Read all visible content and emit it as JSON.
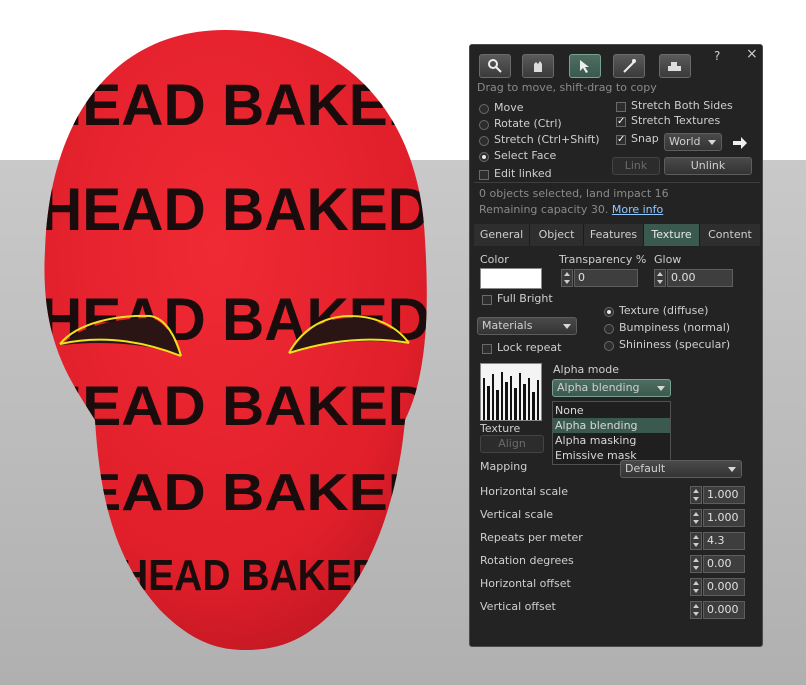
{
  "scene": {
    "face_texture_text": [
      "HEAD BAKED",
      "HEAD BAKED",
      "HEAD BAKED",
      "HEAD BAKED",
      "HEAD BAKED",
      "HEAD BAKED"
    ],
    "face_color": "#e8232e",
    "highlight_color": "#f0e020"
  },
  "panel": {
    "help": "?",
    "close": "×",
    "tools": [
      {
        "icon": "magnifier-icon"
      },
      {
        "icon": "hand-icon"
      },
      {
        "icon": "edit-arrow-icon"
      },
      {
        "icon": "wand-icon"
      },
      {
        "icon": "land-icon"
      }
    ],
    "hint": "Drag to move, shift-drag to copy",
    "modes": {
      "move": "Move",
      "rotate": "Rotate (Ctrl)",
      "stretch": "Stretch (Ctrl+Shift)",
      "select_face": "Select Face",
      "edit_linked": "Edit linked",
      "selected": "Select Face"
    },
    "options": {
      "stretch_both": "Stretch Both Sides",
      "stretch_textures": "Stretch Textures",
      "snap": "Snap",
      "snap_value": "World"
    },
    "link": "Link",
    "unlink": "Unlink",
    "info_line1": "0 objects selected, land impact 16",
    "info_line2": "Remaining capacity 30.",
    "more_info": "More info",
    "tabs": [
      "General",
      "Object",
      "Features",
      "Texture",
      "Content"
    ],
    "active_tab": "Texture",
    "texture": {
      "color_label": "Color",
      "color_value": "#ffffff",
      "transparency_label": "Transparency %",
      "transparency_value": "0",
      "glow_label": "Glow",
      "glow_value": "0.00",
      "full_bright": "Full Bright",
      "materials": "Materials",
      "lock_repeat": "Lock repeat",
      "texture_diffuse": "Texture (diffuse)",
      "bumpiness": "Bumpiness (normal)",
      "shininess": "Shininess (specular)",
      "alpha_mode_label": "Alpha mode",
      "alpha_mode_value": "Alpha blending",
      "alpha_options": [
        "None",
        "Alpha blending",
        "Alpha masking",
        "Emissive mask"
      ],
      "texture_label": "Texture",
      "align": "Align",
      "mapping_label": "Mapping",
      "mapping_value": "Default",
      "rows": [
        {
          "label": "Horizontal scale",
          "value": "1.000"
        },
        {
          "label": "Vertical scale",
          "value": "1.000"
        },
        {
          "label": "Repeats per meter",
          "value": "4.3"
        },
        {
          "label": "Rotation degrees",
          "value": "0.00"
        },
        {
          "label": "Horizontal offset",
          "value": "0.000"
        },
        {
          "label": "Vertical offset",
          "value": "0.000"
        }
      ]
    }
  }
}
